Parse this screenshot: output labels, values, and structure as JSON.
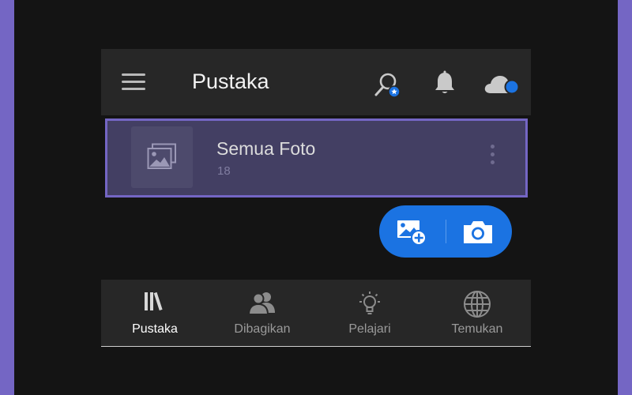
{
  "header": {
    "title": "Pustaka",
    "icons": [
      "menu-icon",
      "search-icon",
      "bell-icon",
      "cloud-icon"
    ]
  },
  "album": {
    "name": "Semua Foto",
    "count": "18",
    "icon": "image-icon"
  },
  "fab": {
    "icons": [
      "add-photo-icon",
      "camera-icon"
    ],
    "color": "#1b73e2"
  },
  "bottom_nav": {
    "items": [
      {
        "label": "Pustaka",
        "icon": "library-icon",
        "active": true
      },
      {
        "label": "Dibagikan",
        "icon": "people-icon",
        "active": false
      },
      {
        "label": "Pelajari",
        "icon": "lightbulb-icon",
        "active": false
      },
      {
        "label": "Temukan",
        "icon": "globe-icon",
        "active": false
      }
    ]
  },
  "colors": {
    "accent": "#7466c4",
    "selection": "#433f63",
    "background": "#141414",
    "bar": "#272727",
    "badge": "#1b73e2"
  }
}
